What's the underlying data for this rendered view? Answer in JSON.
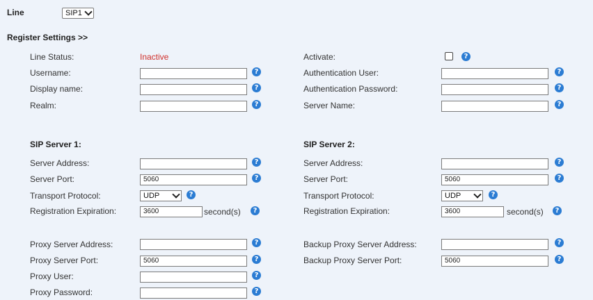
{
  "line": {
    "label": "Line",
    "value": "SIP1"
  },
  "register_title": "Register Settings >>",
  "left": {
    "line_status_label": "Line Status:",
    "line_status_value": "Inactive",
    "username_label": "Username:",
    "display_name_label": "Display name:",
    "realm_label": "Realm:"
  },
  "right": {
    "activate_label": "Activate:",
    "auth_user_label": "Authentication User:",
    "auth_password_label": "Authentication Password:",
    "server_name_label": "Server Name:"
  },
  "sip1": {
    "title": "SIP Server 1:",
    "address_label": "Server Address:",
    "port_label": "Server Port:",
    "port_value": "5060",
    "transport_label": "Transport Protocol:",
    "transport_value": "UDP",
    "expiration_label": "Registration Expiration:",
    "expiration_value": "3600",
    "unit": "second(s)"
  },
  "sip2": {
    "title": "SIP Server 2:",
    "address_label": "Server Address:",
    "port_label": "Server Port:",
    "port_value": "5060",
    "transport_label": "Transport Protocol:",
    "transport_value": "UDP",
    "expiration_label": "Registration Expiration:",
    "expiration_value": "3600",
    "unit": "second(s)"
  },
  "proxy": {
    "address_label": "Proxy Server Address:",
    "port_label": "Proxy Server Port:",
    "port_value": "5060",
    "user_label": "Proxy User:",
    "password_label": "Proxy Password:"
  },
  "backup": {
    "address_label": "Backup Proxy Server Address:",
    "port_label": "Backup Proxy Server Port:",
    "port_value": "5060"
  },
  "help_glyph": "?",
  "colors": {
    "background": "#eef3fa",
    "help": "#2b7cd3",
    "inactive": "#d0302b"
  }
}
